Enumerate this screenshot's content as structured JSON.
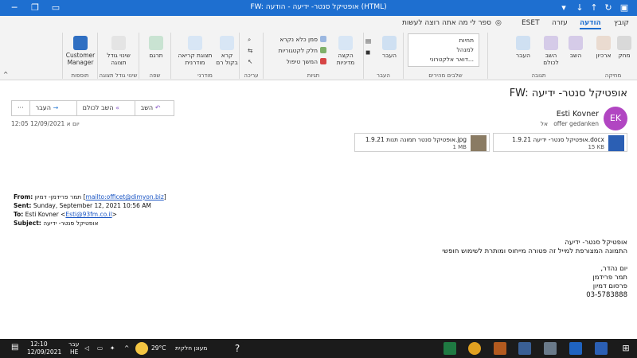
{
  "window": {
    "title": "FW: אופטיקל סנטר- ידיעה - הודעה (HTML)",
    "menu": [
      "קובץ",
      "הודעה",
      "עזרה",
      "ESET"
    ],
    "tell_me": "ספר לי מה אתה רוצה לעשות"
  },
  "ribbon": {
    "groups": {
      "delete": "מחיקה",
      "respond": "תגובה",
      "quicksteps": "שלבים מהירים",
      "move": "העבר",
      "tags": "תגיות",
      "editing": "עריכה",
      "immersive": "מודרני",
      "language": "שפה",
      "zoom": "שינוי גודל תצוגה",
      "addins": "תוספות"
    },
    "buttons": {
      "archive": "ארכיון",
      "delete": "מחק",
      "reply": "השב",
      "reply_all": "השב לכולם",
      "forward": "העבר",
      "move": "העבר",
      "policy": "הקצה מדיניות",
      "speak": "קרא בקול רם",
      "immersive_reader": "תצוגת קריאה מודרנית",
      "translate": "תרגם",
      "zoom": "שינוי גודל תצוגה",
      "customer_manager": "Customer Manager",
      "mark_unread": "סמן כלא נקרא",
      "categorize": "חלק לקטגוריות",
      "follow_up": "המשך טיפול"
    },
    "quicksteps": [
      "תחיות",
      "למנהל",
      "דואר אלקטרוני..."
    ]
  },
  "message": {
    "subject": "FW: אופטיקל סנטר- ידיעה",
    "actions": {
      "reply": "השב",
      "reply_all": "השב לכולם",
      "forward": "העבר"
    },
    "datetime": "יום א 12/09/2021 12:05",
    "sender_initials": "EK",
    "sender_name": "Esti Kovner",
    "to_label": "אל",
    "to_value": "offer gedanken",
    "attachments": [
      {
        "name": "אופטיקל סנטר- ידיעה 1.9.21.docx",
        "size": "15 KB"
      },
      {
        "name": "אופטיקל סנטר תמונה תנות 1.9.21.jpg",
        "size": "1 MB"
      }
    ],
    "forward_header": {
      "from_label": "From:",
      "from_name": "תמר פרידמן- דמיון",
      "from_link": "mailto:officet@dimyon.biz",
      "sent_label": "Sent:",
      "sent_value": "Sunday, September 12, 2021 10:56 AM",
      "to_label": "To:",
      "to_name": "Esti Kovner",
      "to_email": "Esti@93fm.co.il",
      "subject_label": "Subject:",
      "subject_value": "אופטיקל סנטר- ידיעה"
    },
    "body_lines": [
      "אופטיקל סנטר- ידיעה",
      "התמונה המצורפת למייל זה פטורה מייחוס ומותרת לשימוש חופשי",
      "",
      "יום נהדר,",
      "תמר פרידמן",
      "פרסום דמיון",
      "03-5783888"
    ]
  },
  "taskbar": {
    "weather": "מעונן חלקית",
    "temperature": "29°C",
    "lang_main": "עבר",
    "lang_sub": "HE",
    "time": "12:10",
    "date": "12/09/2021"
  }
}
